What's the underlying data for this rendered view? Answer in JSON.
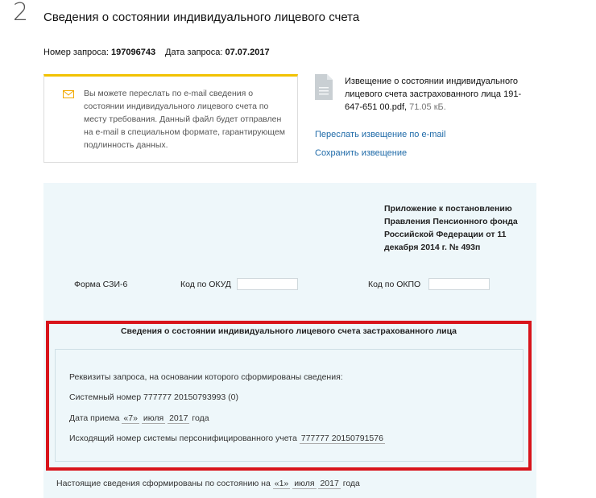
{
  "step": {
    "number": "2",
    "title": "Сведения о состоянии индивидуального лицевого счета"
  },
  "request": {
    "number_label": "Номер запроса:",
    "number_value": "197096743",
    "date_label": "Дата запроса:",
    "date_value": "07.07.2017"
  },
  "info_box": {
    "icon": "envelope-icon",
    "accent_color": "#f2c200",
    "text": "Вы можете переслать по e-mail сведения о состоянии индивидуального лицевого счета по месту требования. Данный файл будет отправлен на e-mail в специальном формате, гарантирующем подлинность данных."
  },
  "document": {
    "icon": "document-icon",
    "name": "Извещение о состоянии индивидуального лицевого счета застрахованного лица 191-647-651 00.pdf",
    "size": "71.05 кБ."
  },
  "links": {
    "send_email": "Переслать извещение по e-mail",
    "save": "Сохранить извещение",
    "color": "#1e6aa8"
  },
  "form": {
    "appendix": "Приложение к постановлению Правления Пенсионного фонда Российской Федерации от 11 декабря 2014 г. № 493п",
    "form_name": "Форма СЗИ-6",
    "okud_label": "Код по ОКУД",
    "okpo_label": "Код по ОКПО",
    "section_title": "Сведения о состоянии индивидуального лицевого счета застрахованного лица",
    "highlight_color": "#d8141b",
    "details_heading": "Реквизиты запроса, на основании которого сформированы сведения:",
    "system_number_label": "Системный номер",
    "system_number_value": "777777 20150793993 (0)",
    "receipt_label": "Дата приема",
    "receipt_day": "«7»",
    "receipt_month": "июля",
    "receipt_year": "2017",
    "year_word": "года",
    "outgoing_label": "Исходящий номер системы персонифицированного учета",
    "outgoing_value": "777777 20150791576",
    "footer_text": "Настоящие сведения сформированы по состоянию на",
    "footer_day": "«1»",
    "footer_month": "июля",
    "footer_year": "2017",
    "footer_year_word": "года"
  }
}
